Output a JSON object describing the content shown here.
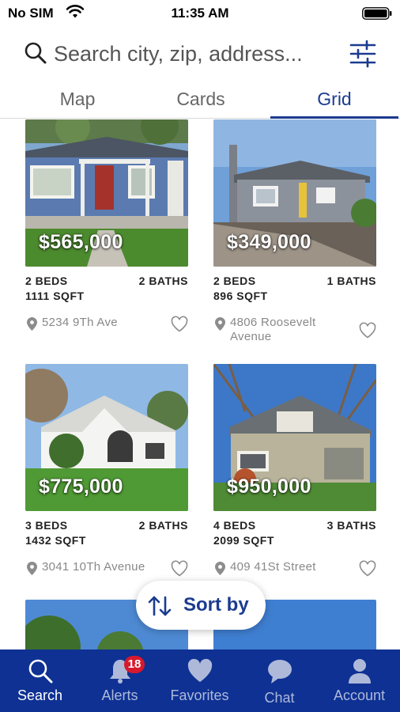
{
  "status_bar": {
    "carrier": "No SIM",
    "time": "11:35 AM"
  },
  "search": {
    "placeholder": "Search city, zip, address..."
  },
  "tabs": [
    {
      "label": "Map"
    },
    {
      "label": "Cards"
    },
    {
      "label": "Grid",
      "active": true
    }
  ],
  "listings": [
    {
      "price": "$565,000",
      "beds": "2 BEDS",
      "baths": "2 BATHS",
      "sqft": "1111 SQFT",
      "address": "5234 9Th Ave"
    },
    {
      "price": "$349,000",
      "beds": "2 BEDS",
      "baths": "1 BATHS",
      "sqft": "896 SQFT",
      "address": "4806 Roosevelt Avenue"
    },
    {
      "price": "$775,000",
      "beds": "3 BEDS",
      "baths": "2 BATHS",
      "sqft": "1432 SQFT",
      "address": "3041 10Th Avenue"
    },
    {
      "price": "$950,000",
      "beds": "4 BEDS",
      "baths": "3 BATHS",
      "sqft": "2099 SQFT",
      "address": "409 41St Street"
    }
  ],
  "sort": {
    "label": "Sort by"
  },
  "bottom_nav": [
    {
      "label": "Search",
      "icon": "search-icon",
      "active": true
    },
    {
      "label": "Alerts",
      "icon": "bell-icon",
      "badge": "18"
    },
    {
      "label": "Favorites",
      "icon": "heart-icon"
    },
    {
      "label": "Chat",
      "icon": "chat-icon"
    },
    {
      "label": "Account",
      "icon": "person-icon"
    }
  ],
  "colors": {
    "brand": "#0e3193",
    "accent": "#1b3b8f",
    "badge": "#d7192d"
  }
}
